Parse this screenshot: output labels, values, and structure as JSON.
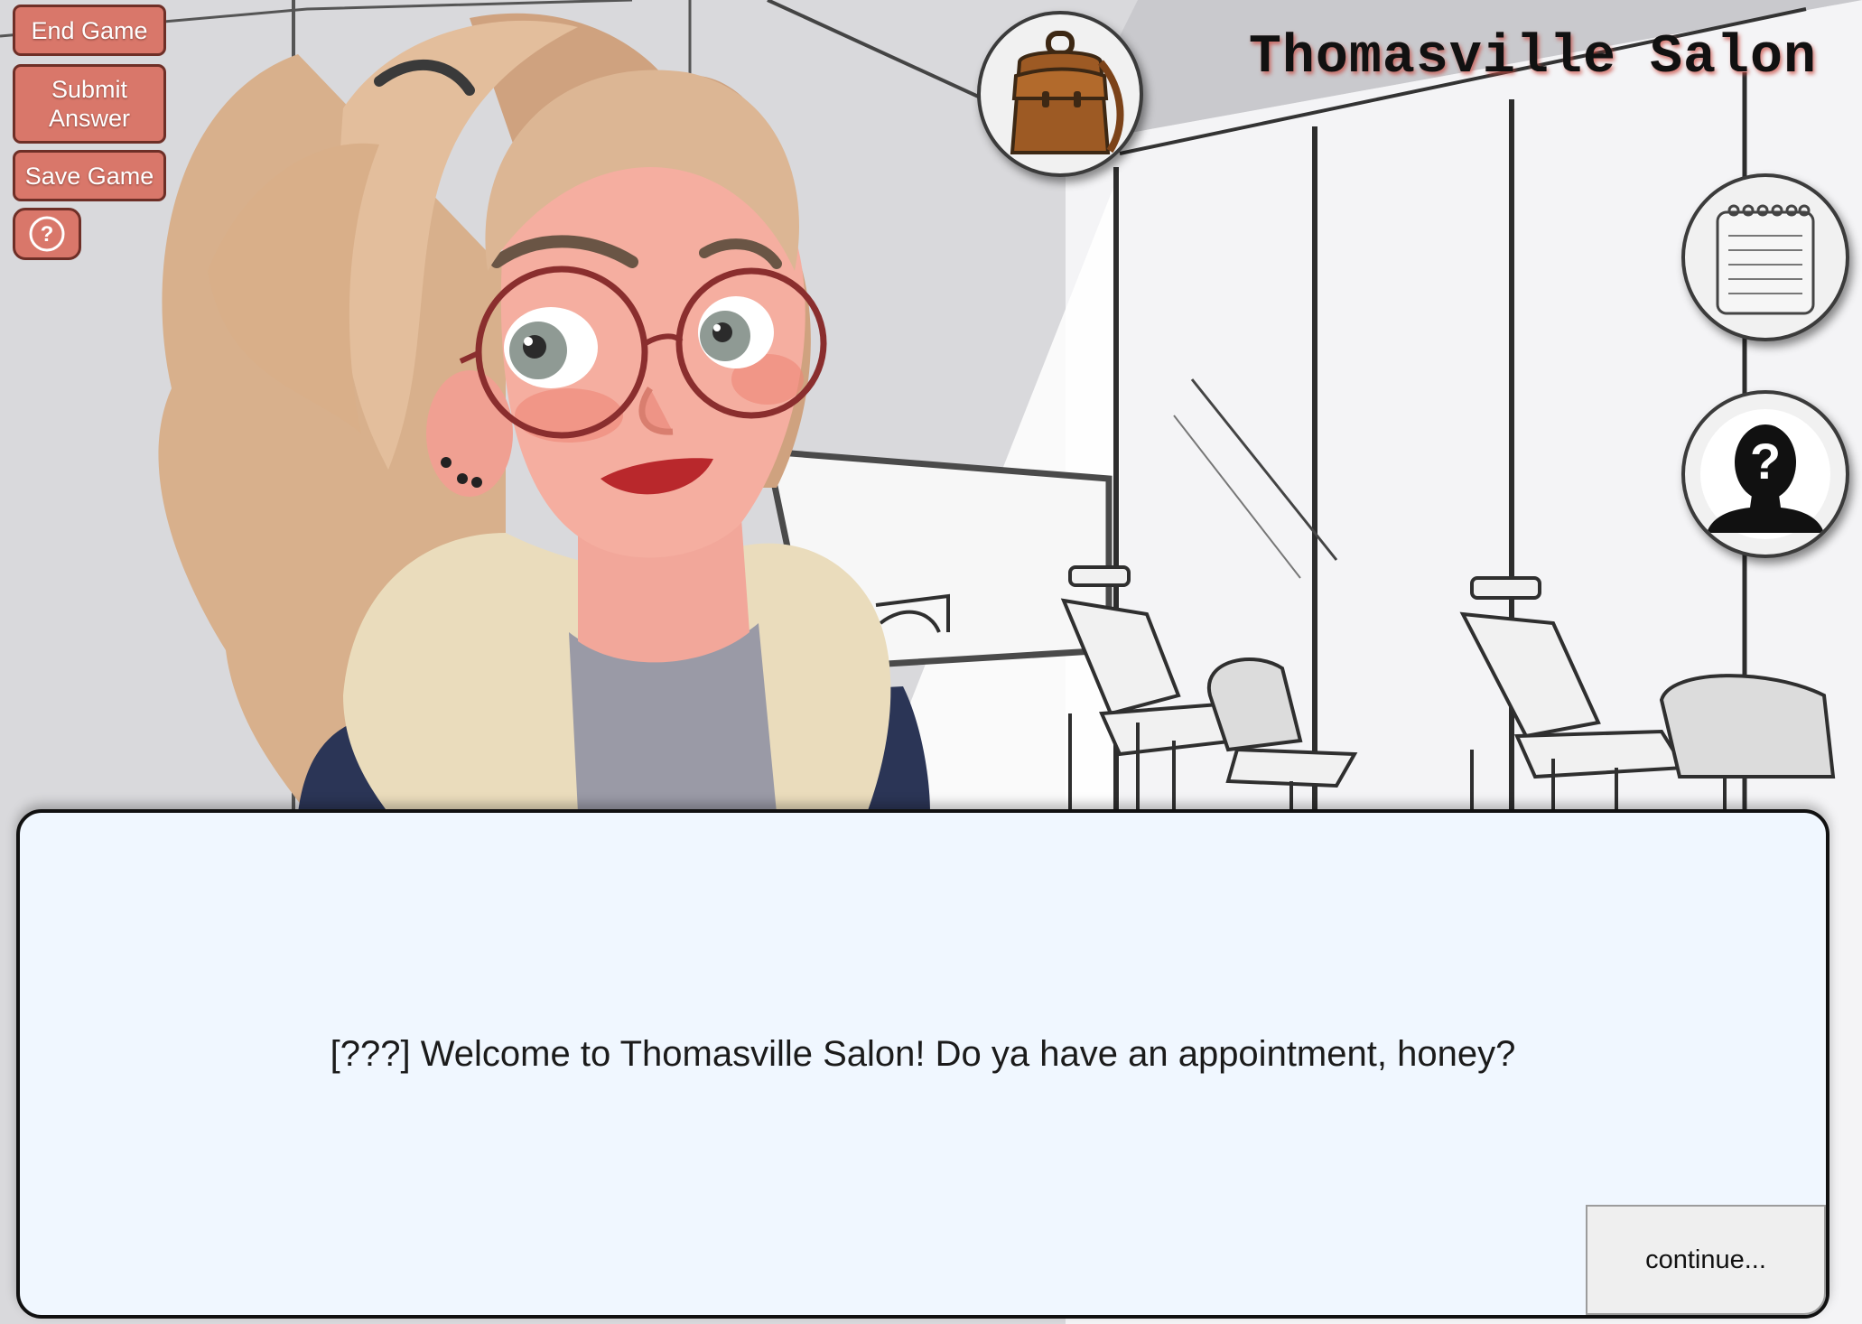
{
  "menu": {
    "end_game": "End Game",
    "submit_answer": "Submit Answer",
    "save_game": "Save Game",
    "help_icon": "question-circle-icon"
  },
  "location_title": "Thomasville Salon",
  "tools": {
    "backpack_icon": "backpack-icon",
    "notepad_icon": "notepad-icon",
    "suspect_icon": "unknown-person-icon"
  },
  "dialog": {
    "text": "[???] Welcome to Thomasville Salon! Do ya have an appointment, honey?",
    "continue": "continue..."
  },
  "colors": {
    "menu_button": "#d9776a",
    "dialog_background": "#f0f7ff",
    "title_glow": "#c8463c"
  }
}
